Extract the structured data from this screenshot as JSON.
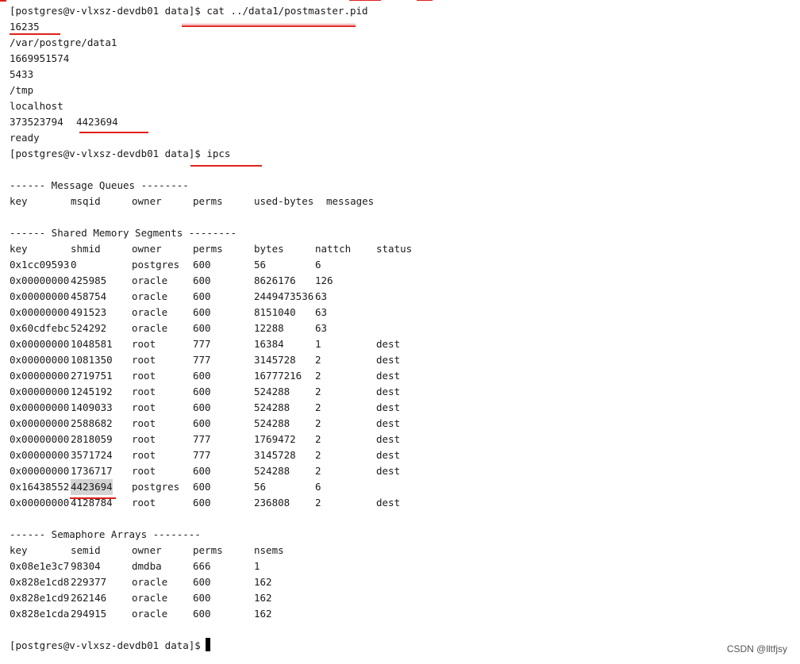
{
  "terminal": {
    "lines": {
      "cmd1": {
        "prompt": "[postgres@v-vlxsz-devdb01 data]$ ",
        "command": "cat ../data1/postmaster.pid"
      },
      "pid": "16235",
      "datadir": "/var/postgre/data1",
      "start_time": "1669951574",
      "port": "5433",
      "socket_dir": "/tmp",
      "listen_addr": "localhost",
      "shm_key": "373523794",
      "shm_id": "4423694",
      "status": "ready",
      "cmd2": {
        "prompt": "[postgres@v-vlxsz-devdb01 data]$ ",
        "command": "ipcs"
      },
      "final_prompt": "[postgres@v-vlxsz-devdb01 data]$"
    },
    "message_queues": {
      "title": "------ Message Queues --------",
      "headers": [
        "key",
        "msqid",
        "owner",
        "perms",
        "used-bytes",
        "messages"
      ]
    },
    "shared_memory": {
      "title": "------ Shared Memory Segments --------",
      "headers": [
        "key",
        "shmid",
        "owner",
        "perms",
        "bytes",
        "nattch",
        "status"
      ],
      "rows": [
        [
          "0x1cc09593",
          "0",
          "postgres",
          "600",
          "56",
          "6",
          ""
        ],
        [
          "0x00000000",
          "425985",
          "oracle",
          "600",
          "8626176",
          "126",
          ""
        ],
        [
          "0x00000000",
          "458754",
          "oracle",
          "600",
          "2449473536",
          "63",
          ""
        ],
        [
          "0x00000000",
          "491523",
          "oracle",
          "600",
          "8151040",
          "63",
          ""
        ],
        [
          "0x60cdfebc",
          "524292",
          "oracle",
          "600",
          "12288",
          "63",
          ""
        ],
        [
          "0x00000000",
          "1048581",
          "root",
          "777",
          "16384",
          "1",
          "dest"
        ],
        [
          "0x00000000",
          "1081350",
          "root",
          "777",
          "3145728",
          "2",
          "dest"
        ],
        [
          "0x00000000",
          "2719751",
          "root",
          "600",
          "16777216",
          "2",
          "dest"
        ],
        [
          "0x00000000",
          "1245192",
          "root",
          "600",
          "524288",
          "2",
          "dest"
        ],
        [
          "0x00000000",
          "1409033",
          "root",
          "600",
          "524288",
          "2",
          "dest"
        ],
        [
          "0x00000000",
          "2588682",
          "root",
          "600",
          "524288",
          "2",
          "dest"
        ],
        [
          "0x00000000",
          "2818059",
          "root",
          "777",
          "1769472",
          "2",
          "dest"
        ],
        [
          "0x00000000",
          "3571724",
          "root",
          "777",
          "3145728",
          "2",
          "dest"
        ],
        [
          "0x00000000",
          "1736717",
          "root",
          "600",
          "524288",
          "2",
          "dest"
        ],
        [
          "0x16438552",
          "4423694",
          "postgres",
          "600",
          "56",
          "6",
          ""
        ],
        [
          "0x00000000",
          "4128784",
          "root",
          "600",
          "236808",
          "2",
          "dest"
        ]
      ]
    },
    "semaphores": {
      "title": "------ Semaphore Arrays --------",
      "headers": [
        "key",
        "semid",
        "owner",
        "perms",
        "nsems"
      ],
      "rows": [
        [
          "0x08e1e3c7",
          "98304",
          "dmdba",
          "666",
          "1"
        ],
        [
          "0x828e1cd8",
          "229377",
          "oracle",
          "600",
          "162"
        ],
        [
          "0x828e1cd9",
          "262146",
          "oracle",
          "600",
          "162"
        ],
        [
          "0x828e1cda",
          "294915",
          "oracle",
          "600",
          "162"
        ]
      ]
    }
  },
  "watermark": "CSDN @lltfjsy",
  "colors": {
    "annotation": "#e0201c",
    "highlight": "#d4d4d4"
  }
}
